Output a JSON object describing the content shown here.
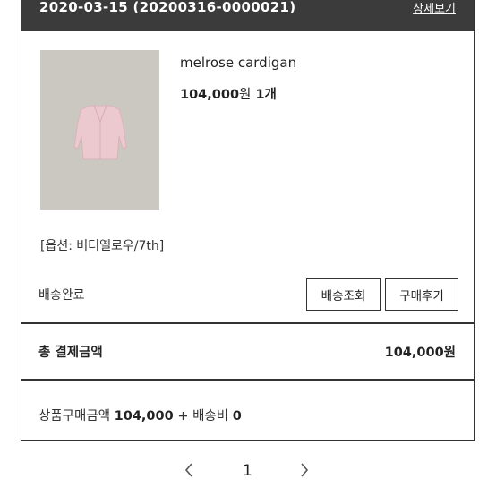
{
  "order": {
    "date_line": "2020-03-15 (20200316-0000021)",
    "detail_link": "상세보기"
  },
  "product": {
    "name": "melrose cardigan",
    "price": "104,000",
    "price_unit": "원",
    "quantity": "1개",
    "option": "[옵션: 버터옐로우/7th]",
    "image_icon": "cardigan-photo"
  },
  "status": {
    "label": "배송완료",
    "track_button": "배송조회",
    "review_button": "구매후기"
  },
  "total": {
    "label": "총 결제금액",
    "value": "104,000원"
  },
  "summary": {
    "prefix": "상품구매금액",
    "product_amount": "104,000",
    "plus": "+ 배송비",
    "shipping": "0"
  },
  "pagination": {
    "prev_icon": "chevron-left-icon",
    "current": "1",
    "next_icon": "chevron-right-icon"
  },
  "colors": {
    "header_bg": "#3b3b3b",
    "thumb_bg": "#cbc8c1",
    "cardigan": "#ecc8cf"
  }
}
